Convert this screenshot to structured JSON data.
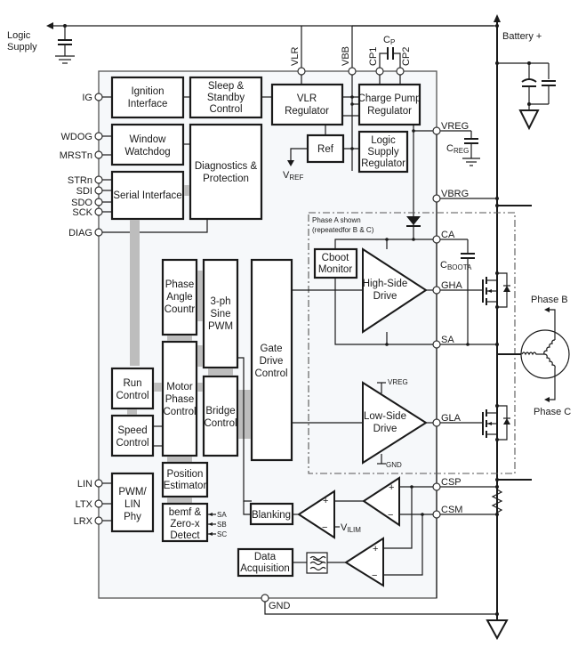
{
  "external": {
    "logic_supply": [
      "Logic",
      "Supply"
    ],
    "battery": "Battery +",
    "cp_cap": "C",
    "cp_cap_sub": "P",
    "creg": "C",
    "creg_sub": "REG",
    "cboot": "C",
    "cboot_sub": "BOOTA",
    "phase_b": "Phase B",
    "phase_c": "Phase C",
    "vref": "V",
    "vref_sub": "REF",
    "vilim": "V",
    "vilim_sub": "ILIM"
  },
  "pins": {
    "left": [
      "IG",
      "WDOG",
      "MRSTn",
      "STRn",
      "SDI",
      "SDO",
      "SCK",
      "DIAG",
      "LIN",
      "LTX",
      "LRX"
    ],
    "top": [
      "VLR",
      "VBB",
      "CP1",
      "CP2"
    ],
    "right": [
      "VREG",
      "VBRG",
      "CA",
      "GHA",
      "SA",
      "GLA",
      "CSP",
      "CSM"
    ],
    "bottom": [
      "GND"
    ]
  },
  "blocks": {
    "ignition": [
      "Ignition",
      "Interface"
    ],
    "sleep": [
      "Sleep &",
      "Standby",
      "Control"
    ],
    "vlr": [
      "VLR",
      "Regulator"
    ],
    "charge_pump": [
      "Charge Pump",
      "Regulator"
    ],
    "ref": [
      "Ref"
    ],
    "logic_reg": [
      "Logic",
      "Supply",
      "Regulator"
    ],
    "watchdog": [
      "Window",
      "Watchdog"
    ],
    "diagnostics": [
      "Diagnostics &",
      "Protection"
    ],
    "serial": [
      "Serial Interface"
    ],
    "phase_angle": [
      "Phase",
      "Angle",
      "Countr"
    ],
    "sine_pwm": [
      "3-ph",
      "Sine",
      "PWM"
    ],
    "gate_drive": [
      "Gate",
      "Drive",
      "Control"
    ],
    "run": [
      "Run",
      "Control"
    ],
    "motor_phase": [
      "Motor",
      "Phase",
      "Control"
    ],
    "bridge": [
      "Bridge",
      "Control"
    ],
    "speed": [
      "Speed",
      "Control"
    ],
    "position": [
      "Position",
      "Estimator"
    ],
    "bemf": [
      "bemf &",
      "Zero-x",
      "Detect"
    ],
    "pwm_lin": [
      "PWM/",
      "LIN",
      "Phy"
    ],
    "blanking": [
      "Blanking"
    ],
    "data_acq": [
      "Data",
      "Acquisition"
    ],
    "cboot_mon": [
      "Cboot",
      "Monitor"
    ],
    "hs_drive": [
      "High-Side",
      "Drive"
    ],
    "ls_drive": [
      "Low-Side",
      "Drive"
    ]
  },
  "phase_box": [
    "Phase A shown",
    "(repeatedfor B & C)"
  ],
  "ls_supply": {
    "top": "VREG",
    "bottom": "GND"
  },
  "bemf_inputs": [
    "SA",
    "SB",
    "SC"
  ],
  "opamp_signs": {
    "plus": "+",
    "minus": "−"
  }
}
